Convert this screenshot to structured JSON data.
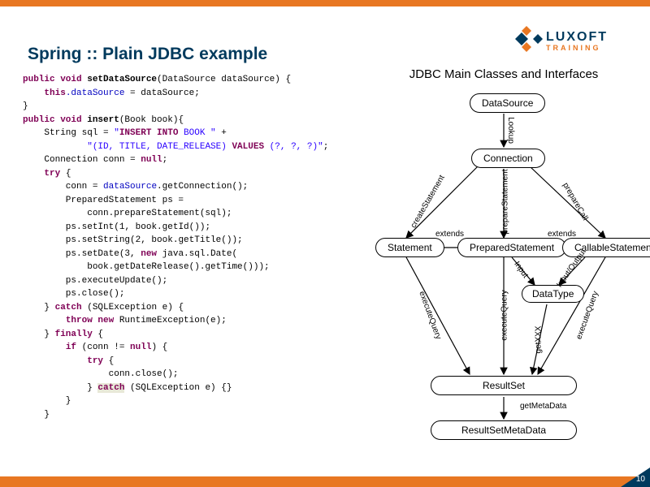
{
  "logo": {
    "main": "LUXOFT",
    "sub": "TRAINING"
  },
  "title": "Spring :: Plain JDBC example",
  "page_number": "10",
  "code": {
    "l1_kw1": "public void ",
    "l1_method": "setDataSource",
    "l1_rest": "(DataSource dataSource) {",
    "l2_kw": "this",
    "l2_field": ".dataSource",
    "l2_rest": " = dataSource;",
    "l3": "}",
    "l4_kw1": "public void ",
    "l4_method": "insert",
    "l4_rest": "(Book book){",
    "l5": "",
    "l6_a": "    String sql = ",
    "l6_s1": "\"",
    "l6_sql1": "INSERT INTO ",
    "l6_s2": "BOOK \"",
    "l6_plus": " +",
    "l7_s1": "\"(ID, TITLE, DATE_RELEASE) ",
    "l7_sql2": "VALUES ",
    "l7_s2": "(?, ?, ?)\"",
    "l7_semi": ";",
    "l8_a": "    Connection conn = ",
    "l8_kw": "null",
    "l8_b": ";",
    "l9_kw": "try",
    "l9_rest": " {",
    "l10_a": "        conn = ",
    "l10_field": "dataSource",
    "l10_b": ".getConnection();",
    "l11": "        PreparedStatement ps =",
    "l12": "            conn.prepareStatement(sql);",
    "l13_a": "        ps.setInt(",
    "l13_n": "1",
    "l13_b": ", book.getId());",
    "l14_a": "        ps.setString(",
    "l14_n": "2",
    "l14_b": ", book.getTitle());",
    "l15_a": "        ps.setDate(",
    "l15_n": "3",
    "l15_b": ", ",
    "l15_kw": "new",
    "l15_c": " java.sql.Date(",
    "l16": "            book.getDateRelease().getTime()));",
    "l17": "        ps.executeUpdate();",
    "l18": "        ps.close();",
    "l19": "",
    "l20_a": "    } ",
    "l20_kw": "catch",
    "l20_b": " (SQLException e) {",
    "l21_kw": "throw new ",
    "l21_rest": "RuntimeException(e);",
    "l22_a": "    } ",
    "l22_kw": "finally",
    "l22_b": " {",
    "l23_kw": "if",
    "l23_a": " (conn != ",
    "l23_kw2": "null",
    "l23_b": ") {",
    "l24_kw": "try",
    "l24_rest": " {",
    "l25": "                conn.close();",
    "l26_a": "            } ",
    "l26_kw": "catch",
    "l26_b": " (SQLException e) {}",
    "l27": "        }",
    "l28": "    }"
  },
  "diagram": {
    "title": "JDBC Main Classes and Interfaces",
    "nodes": {
      "datasource": "DataSource",
      "connection": "Connection",
      "statement": "Statement",
      "prepared": "PreparedStatement",
      "callable": "CallableStatement",
      "datatype": "DataType",
      "resultset": "ResultSet",
      "rsmeta": "ResultSetMetaData"
    },
    "edges": {
      "lookup": "Lookup",
      "createStatement": "createStatement",
      "prepareStatement": "prepareStatement",
      "prepareCall": "prepareCall",
      "extends1": "extends",
      "extends2": "extends",
      "executeQuery1": "executeQuery",
      "executeQuery2": "executeQuery",
      "executeQuery3": "executeQuery",
      "input": "Input",
      "inputoutput": "Input/Output",
      "getxxx": "getXXX",
      "getMetaData": "getMetaData"
    }
  }
}
